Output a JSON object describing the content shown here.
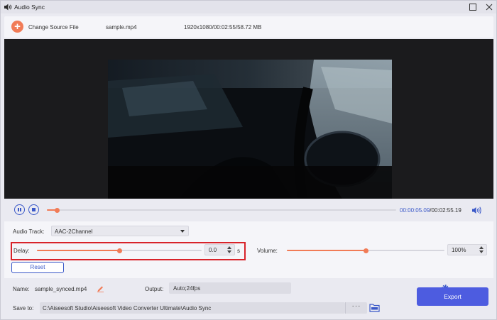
{
  "window": {
    "title": "Audio Sync"
  },
  "file_bar": {
    "change_source_label": "Change Source File",
    "file_name": "sample.mp4",
    "file_info": "1920x1080/00:02:55/58.72 MB"
  },
  "playback": {
    "current_time": "00:00:05.09",
    "separator": "/",
    "total_time": "00:02:55.19",
    "progress_fraction": 0.029
  },
  "audio_track": {
    "label": "Audio Track:",
    "selected": "AAC-2Channel"
  },
  "delay": {
    "label": "Delay:",
    "value": "0.0",
    "unit": "s",
    "slider_fraction": 0.5
  },
  "volume": {
    "label": "Volume:",
    "value": "100%",
    "slider_fraction": 0.5
  },
  "reset_label": "Reset",
  "name": {
    "label": "Name:",
    "value": "sample_synced.mp4"
  },
  "output": {
    "label": "Output:",
    "value": "Auto;24fps"
  },
  "save_to": {
    "label": "Save to:",
    "path": "C:\\Aiseesoft Studio\\Aiseesoft Video Converter Ultimate\\Audio Sync",
    "more_label": "···"
  },
  "export_label": "Export",
  "colors": {
    "accent": "#f17b56",
    "primary": "#4d5ce0",
    "highlight": "#d8232a"
  },
  "icons": [
    "audio-sync-app-icon",
    "maximize-icon",
    "close-icon",
    "add-icon",
    "pause-icon",
    "stop-icon",
    "volume-icon",
    "dropdown-caret-icon",
    "edit-icon",
    "gear-icon",
    "folder-icon"
  ]
}
